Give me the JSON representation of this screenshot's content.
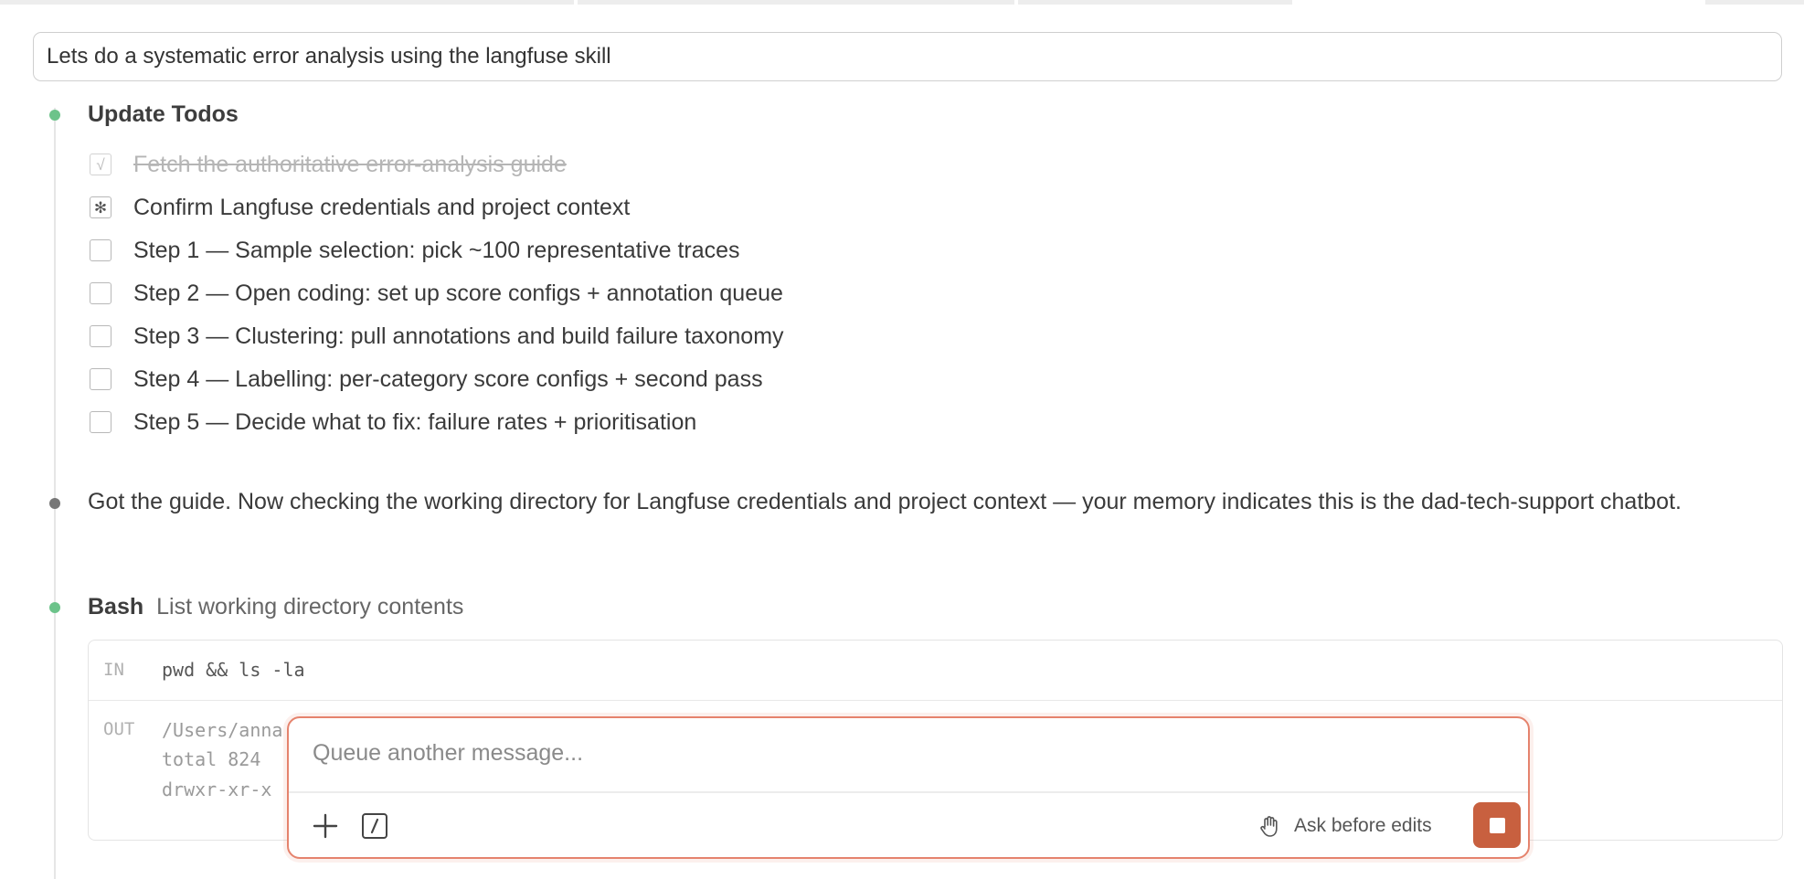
{
  "prompt": {
    "text": "Lets do a systematic error analysis using the langfuse skill"
  },
  "todos": {
    "heading": "Update Todos",
    "items": [
      {
        "label": "Fetch the authoritative error-analysis guide",
        "status": "completed",
        "mark": "√"
      },
      {
        "label": "Confirm Langfuse credentials and project context",
        "status": "in-progress",
        "mark": "✻"
      },
      {
        "label": "Step 1 — Sample selection: pick ~100 representative traces",
        "status": "pending",
        "mark": ""
      },
      {
        "label": "Step 2 — Open coding: set up score configs + annotation queue",
        "status": "pending",
        "mark": ""
      },
      {
        "label": "Step 3 — Clustering: pull annotations and build failure taxonomy",
        "status": "pending",
        "mark": ""
      },
      {
        "label": "Step 4 — Labelling: per-category score configs + second pass",
        "status": "pending",
        "mark": ""
      },
      {
        "label": "Step 5 — Decide what to fix: failure rates + prioritisation",
        "status": "pending",
        "mark": ""
      }
    ]
  },
  "message": {
    "text": "Got the guide. Now checking the working directory for Langfuse credentials and project context — your memory indicates this is the dad-tech-support chatbot."
  },
  "bash": {
    "title": "Bash",
    "description": "List working directory contents",
    "in_label": "IN",
    "command": "pwd && ls -la",
    "out_label": "OUT",
    "out_lines": [
      "/Users/anna",
      "total 824",
      "drwxr-xr-x"
    ]
  },
  "queue": {
    "placeholder": "Queue another message...",
    "ask_label": "Ask before edits",
    "icons": {
      "add": "plus-icon",
      "slash": "slash-command-icon",
      "hand": "hand-icon",
      "stop": "stop-icon"
    }
  },
  "colors": {
    "accent": "#c8603f",
    "border_accent": "#e5836d",
    "status_green": "#6cc38a"
  }
}
